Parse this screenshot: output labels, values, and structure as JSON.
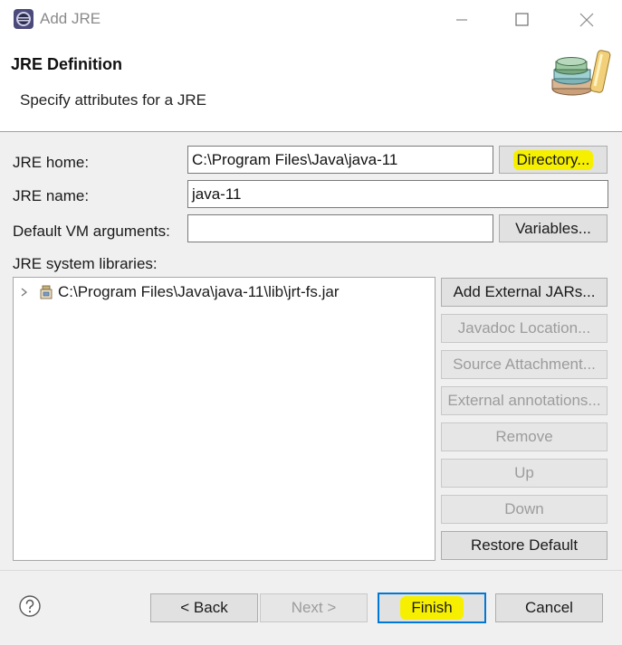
{
  "window": {
    "title": "Add JRE",
    "minimize_icon": "minimize-icon",
    "maximize_icon": "maximize-icon",
    "close_icon": "close-icon"
  },
  "header": {
    "title": "JRE Definition",
    "description": "Specify attributes for a JRE",
    "image_icon": "jre-books-icon"
  },
  "form": {
    "jre_home_label": "JRE home:",
    "jre_home_value": "C:\\Program Files\\Java\\java-11",
    "directory_button": "Directory...",
    "jre_name_label": "JRE name:",
    "jre_name_value": "java-11",
    "vm_args_label": "Default VM arguments:",
    "vm_args_value": "",
    "variables_button": "Variables...",
    "libraries_label": "JRE system libraries:"
  },
  "libraries": {
    "items": [
      {
        "label": "C:\\Program Files\\Java\\java-11\\lib\\jrt-fs.jar",
        "icon": "jar-file-icon",
        "expanded": false
      }
    ]
  },
  "library_buttons": {
    "add_external_jars": "Add External JARs...",
    "javadoc_location": "Javadoc Location...",
    "source_attachment": "Source Attachment...",
    "external_annotations": "External annotations...",
    "remove": "Remove",
    "up": "Up",
    "down": "Down",
    "restore_default": "Restore Default"
  },
  "footer": {
    "help_icon": "help-icon",
    "back": "< Back",
    "next": "Next >",
    "finish": "Finish",
    "cancel": "Cancel"
  },
  "colors": {
    "highlight": "#f6f000",
    "default_button_border": "#0078d7",
    "panel_background": "#f0f0f0"
  }
}
